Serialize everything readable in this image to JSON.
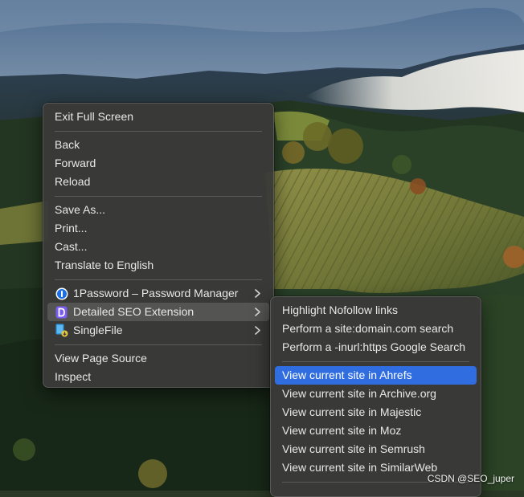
{
  "main_menu": {
    "exit_full_screen": "Exit Full Screen",
    "back": "Back",
    "forward": "Forward",
    "reload": "Reload",
    "save_as": "Save As...",
    "print": "Print...",
    "cast": "Cast...",
    "translate": "Translate to English",
    "ext_1password": "1Password – Password Manager",
    "ext_detailed_seo": "Detailed SEO Extension",
    "ext_singlefile": "SingleFile",
    "view_page_source": "View Page Source",
    "inspect": "Inspect"
  },
  "submenu": {
    "highlight_nofollow": "Highlight Nofollow links",
    "site_search": "Perform a site:domain.com search",
    "inurl_search": "Perform a -inurl:https Google Search",
    "ahrefs": "View current site in Ahrefs",
    "archive": "View current site in Archive.org",
    "majestic": "View current site in Majestic",
    "moz": "View current site in Moz",
    "semrush": "View current site in Semrush",
    "similarweb": "View current site in SimilarWeb"
  },
  "watermark": "CSDN @SEO_juper",
  "icons": {
    "onepassword": "1password-icon",
    "detailed_seo": "detailed-seo-icon",
    "singlefile": "singlefile-icon",
    "chevron": "chevron-right-icon"
  },
  "colors": {
    "menu_background": "#3a3a38",
    "selected_highlight": "#2f6de0",
    "hover_highlight": "#5a5a58",
    "detailed_seo_icon": "#7b5cf0",
    "onepassword_icon": "#1a6ee6"
  }
}
